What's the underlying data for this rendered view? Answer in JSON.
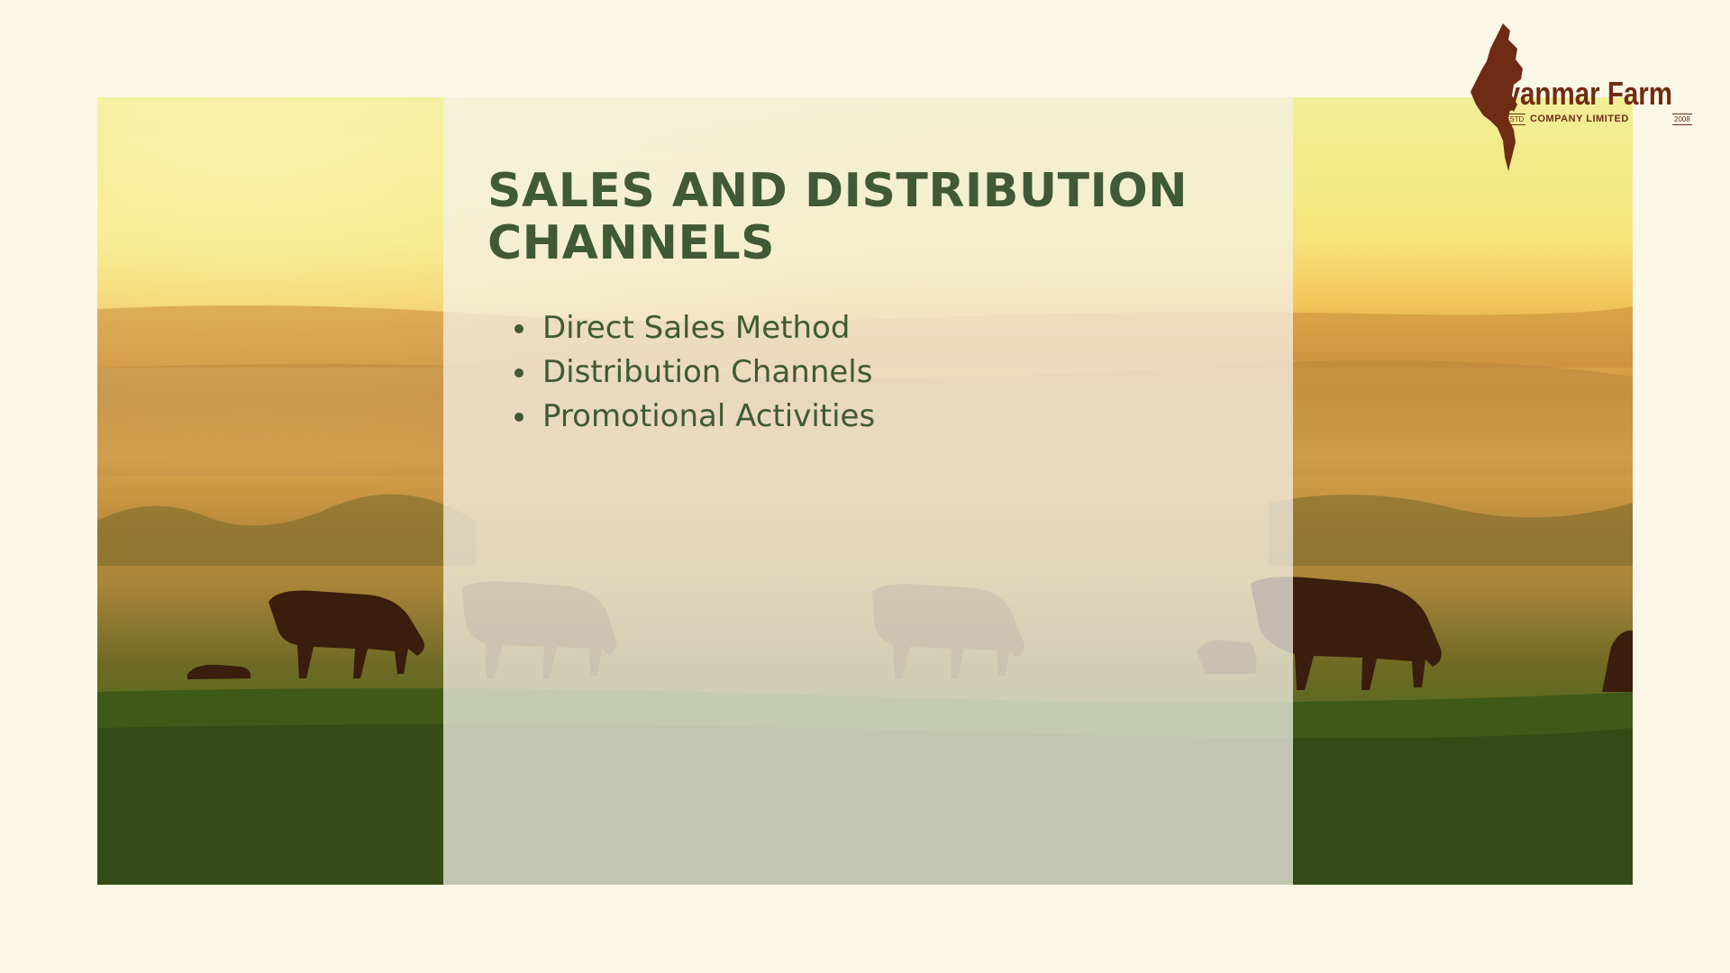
{
  "slide": {
    "title": "SALES AND DISTRIBUTION CHANNELS",
    "bullets": [
      "Direct Sales Method",
      "Distribution Channels",
      "Promotional Activities"
    ],
    "background_image": "cattle-grazing-sunrise-meadow"
  },
  "logo": {
    "name": "Myanmar Farm",
    "estd": "ESTD",
    "subtitle": "COMPANY LIMITED",
    "year": "2008",
    "icon": "myanmar-map-icon"
  },
  "colors": {
    "page_background": "#fbf7e6",
    "title_text": "#3f5a35",
    "logo_brown": "#6e2c14",
    "sky_top": "#f3ec8a",
    "grass": "#4e6a1f"
  }
}
